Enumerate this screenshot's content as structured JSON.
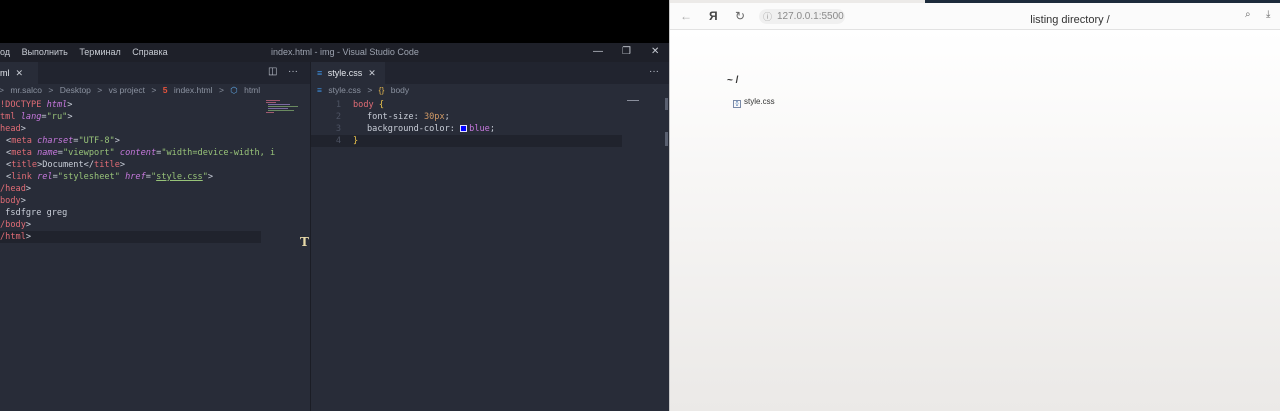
{
  "vscode": {
    "menu": [
      "од",
      "Выполнить",
      "Терминал",
      "Справка"
    ],
    "window_title": "index.html - img - Visual Studio Code",
    "left_tab": {
      "label": "ml",
      "close": "✕"
    },
    "right_tab": {
      "label": "style.css",
      "close": "✕"
    },
    "left_breadcrumb": [
      "mr.salco",
      ">",
      "Desktop",
      ">",
      "vs project",
      ">",
      "index.html",
      ">",
      "html"
    ],
    "right_breadcrumb": [
      "style.css",
      ">",
      "body"
    ],
    "right_line_numbers": [
      "1",
      "2",
      "3",
      "4"
    ]
  },
  "browser": {
    "address": "127.0.0.1:5500",
    "tab_title": "listing directory /",
    "heading": "~ /",
    "file_name": "style.css"
  },
  "colors": {
    "editor_bg": "#282c38",
    "tag": "#e06c75",
    "attribute": "#c678dd",
    "string": "#98c379",
    "number": "#d19a66",
    "brace": "#f2c94c"
  },
  "icons": [
    "close-icon",
    "split-editor-icon",
    "more-icon",
    "minimize-icon",
    "maximize-icon",
    "window-close-icon",
    "html5-icon",
    "element-icon",
    "css3-icon",
    "symbol-icon",
    "back-icon",
    "yandex-icon",
    "reload-icon",
    "info-icon",
    "search-page-icon",
    "download-icon",
    "file-icon"
  ]
}
